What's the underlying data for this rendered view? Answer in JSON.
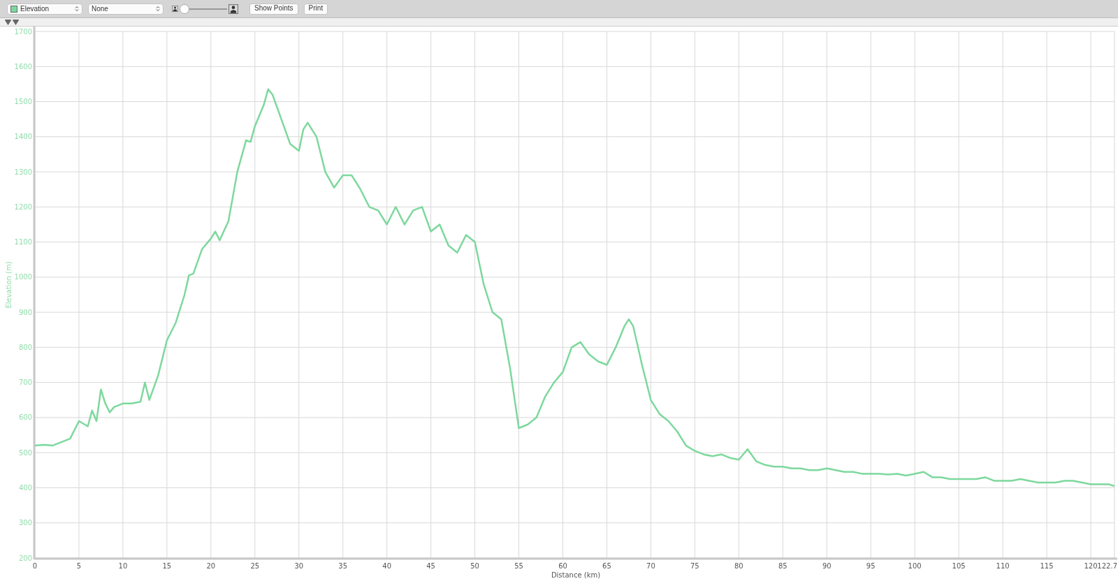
{
  "toolbar": {
    "metric_popup": {
      "label": "Elevation",
      "color": "#7dd89d"
    },
    "overlay_popup": {
      "label": "None"
    },
    "zoom_slider": {
      "level": 0
    },
    "buttons": [
      "Show Points",
      "Print"
    ]
  },
  "chart": {
    "chart_data": {
      "type": "line",
      "xlabel": "Distance (km)",
      "ylabel": "Elevation (m)",
      "x": [
        0,
        1,
        2,
        3,
        4,
        5,
        6,
        6.5,
        7,
        7.5,
        8,
        8.5,
        9,
        10,
        11,
        12,
        12.5,
        13,
        14,
        15,
        16,
        17,
        17.5,
        18,
        19,
        20,
        20.5,
        21,
        22,
        23,
        24,
        24.5,
        25,
        26,
        26.5,
        27,
        28,
        29,
        30,
        30.5,
        31,
        32,
        33,
        34,
        35,
        36,
        37,
        38,
        39,
        40,
        41,
        42,
        43,
        44,
        45,
        46,
        47,
        48,
        49,
        50,
        51,
        52,
        53,
        54,
        55,
        56,
        57,
        58,
        59,
        60,
        61,
        62,
        63,
        64,
        65,
        66,
        67,
        67.5,
        68,
        69,
        70,
        71,
        72,
        73,
        74,
        75,
        76,
        77,
        78,
        79,
        80,
        81,
        82,
        83,
        84,
        85,
        86,
        87,
        88,
        89,
        90,
        91,
        92,
        93,
        94,
        95,
        96,
        97,
        98,
        99,
        100,
        101,
        102,
        103,
        104,
        105,
        106,
        107,
        108,
        109,
        110,
        111,
        112,
        113,
        114,
        115,
        116,
        117,
        118,
        119,
        120,
        121,
        122,
        122.7
      ],
      "series": [
        {
          "color": "#7dd89d",
          "values": [
            520,
            522,
            520,
            530,
            540,
            590,
            575,
            620,
            590,
            680,
            640,
            615,
            630,
            640,
            640,
            645,
            700,
            650,
            720,
            820,
            870,
            950,
            1005,
            1010,
            1080,
            1110,
            1130,
            1105,
            1160,
            1300,
            1390,
            1385,
            1430,
            1490,
            1535,
            1520,
            1450,
            1380,
            1360,
            1420,
            1440,
            1400,
            1300,
            1255,
            1290,
            1290,
            1250,
            1200,
            1190,
            1150,
            1200,
            1150,
            1190,
            1200,
            1130,
            1150,
            1090,
            1070,
            1120,
            1100,
            980,
            900,
            880,
            740,
            570,
            580,
            600,
            660,
            700,
            730,
            800,
            815,
            780,
            760,
            750,
            800,
            860,
            880,
            860,
            750,
            650,
            610,
            590,
            560,
            520,
            505,
            495,
            490,
            495,
            485,
            480,
            510,
            475,
            465,
            460,
            460,
            455,
            455,
            450,
            450,
            455,
            450,
            445,
            445,
            440,
            440,
            440,
            438,
            440,
            435,
            440,
            445,
            430,
            430,
            425,
            425,
            425,
            425,
            430,
            420,
            420,
            420,
            425,
            420,
            415,
            415,
            415,
            420,
            420,
            415,
            410,
            410,
            410,
            405
          ]
        }
      ],
      "grid": true,
      "xlim": [
        0,
        122.7
      ],
      "ylim": [
        200,
        1700
      ],
      "xticks": [
        0,
        5,
        10,
        15,
        20,
        25,
        30,
        35,
        40,
        45,
        50,
        55,
        60,
        65,
        70,
        75,
        80,
        85,
        90,
        95,
        100,
        105,
        110,
        115,
        120,
        {
          "value": 122.7,
          "label": "122.7"
        }
      ],
      "yticks": [
        200,
        300,
        400,
        500,
        600,
        700,
        800,
        900,
        1000,
        1100,
        1200,
        1300,
        1400,
        1500,
        1600,
        1700
      ]
    }
  }
}
